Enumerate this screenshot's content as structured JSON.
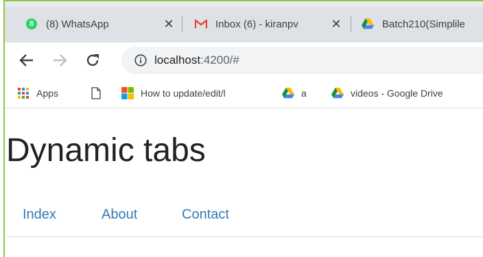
{
  "browser": {
    "tabs": [
      {
        "title": "(8) WhatsApp",
        "icon": "whatsapp-icon",
        "badge": "8"
      },
      {
        "title": "Inbox (6) - kiranpv",
        "icon": "gmail-icon"
      },
      {
        "title": "Batch210(Simplile",
        "icon": "google-drive-icon"
      }
    ],
    "close_glyph": "✕",
    "address": {
      "host": "localhost",
      "rest": ":4200/#"
    },
    "bookmarks": [
      {
        "label": "Apps",
        "icon": "apps-grid-icon"
      },
      {
        "label": "",
        "icon": "page-icon"
      },
      {
        "label": "How to update/edit/l",
        "icon": "microsoft-icon"
      },
      {
        "label": "a",
        "icon": "google-drive-icon"
      },
      {
        "label": "videos - Google Drive",
        "icon": "google-drive-icon"
      }
    ]
  },
  "page": {
    "title": "Dynamic tabs",
    "nav": [
      "Index",
      "About",
      "Contact"
    ]
  },
  "colors": {
    "link": "#337ab7",
    "accent_border": "#8dc63f",
    "gmail_red": "#ea4335",
    "whatsapp_green": "#25d366"
  }
}
